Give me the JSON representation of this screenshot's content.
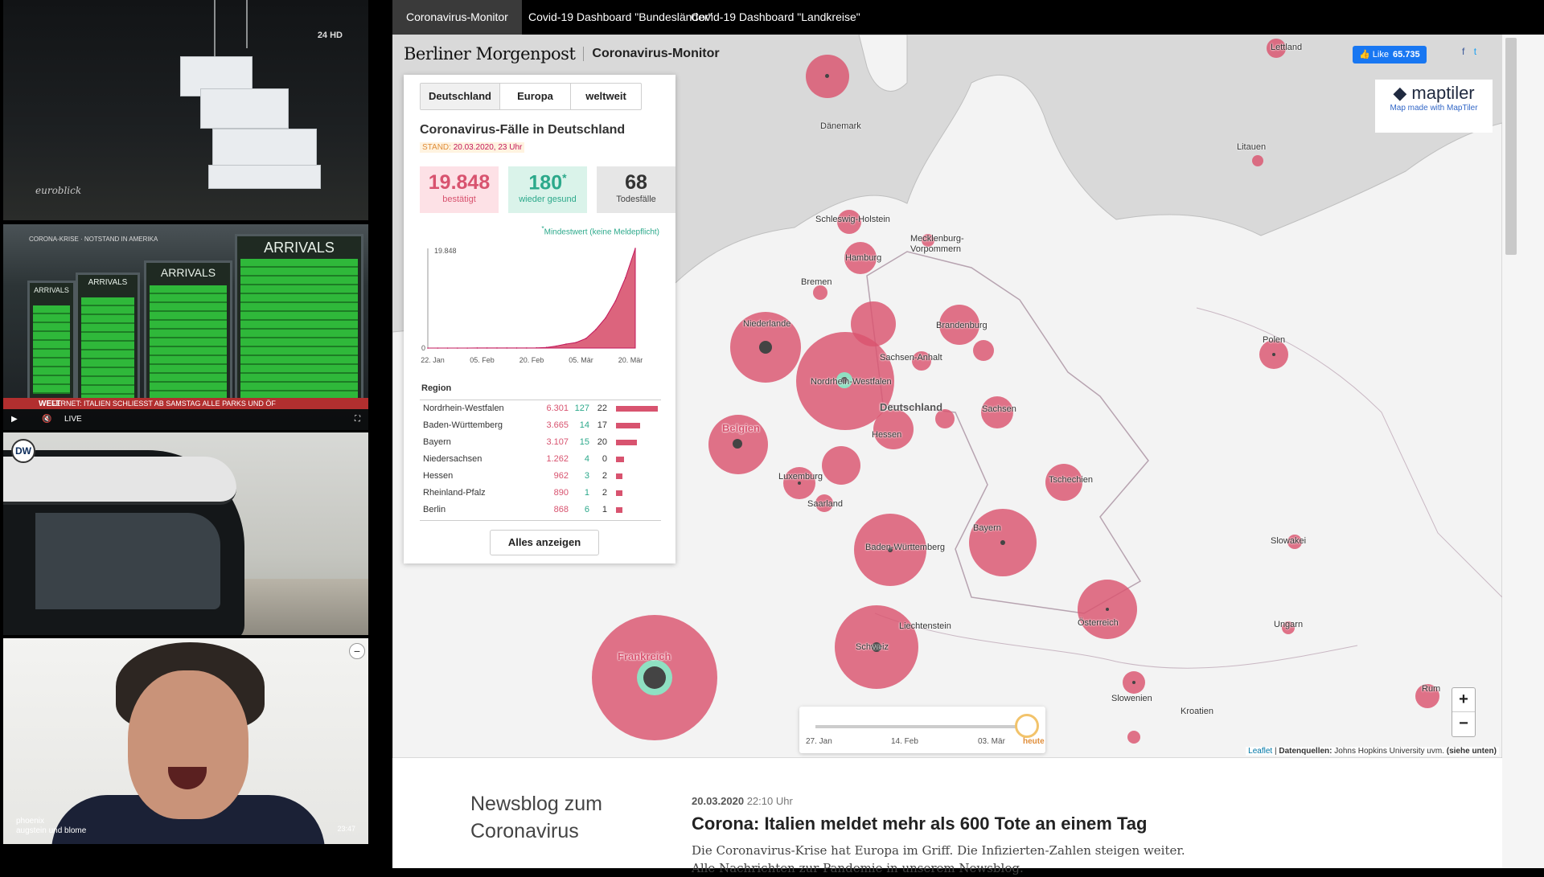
{
  "videos": {
    "tile1": {
      "channel_badge": "24\nHD",
      "logo_text": "euroblick"
    },
    "tile2": {
      "ticker_top": "CORONA-KRISE · NOTSTAND IN AMERIKA",
      "board_titles": [
        "ARRIVALS",
        "ARRIVALS",
        "ARRIVALS",
        "ARRIVALS"
      ],
      "ticker": "FERNET: ITALIEN SCHLIESST AB SAMSTAG ALLE PARKS UND ÖF",
      "live_label": "LIVE",
      "channel": "WELT"
    },
    "tile3": {
      "logo_text": "DW"
    },
    "tile4": {
      "line1": "phoenix",
      "line2": "augstein und blome",
      "time": "23:47"
    }
  },
  "tabs": [
    {
      "label": "Coronavirus-Monitor",
      "active": true
    },
    {
      "label": "Covid-19 Dashboard \"Bundesländer\"",
      "active": false
    },
    {
      "label": "Covid-19 Dashboard \"Landkreise\"",
      "active": false
    }
  ],
  "header": {
    "logo": "Berliner Morgenpost",
    "title": "Coronavirus-Monitor"
  },
  "facebook": {
    "like_label": "Like",
    "count": "65.735"
  },
  "maptiler": {
    "logo": "maptiler",
    "subtitle": "Map made with MapTiler"
  },
  "card": {
    "segments": [
      "Deutschland",
      "Europa",
      "weltweit"
    ],
    "title": "Coronavirus-Fälle in Deutschland",
    "stand_label": "STAND:",
    "stand_value": "20.03.2020, 23 Uhr",
    "kpis": {
      "confirmed": {
        "value": "19.848",
        "label": "bestätigt"
      },
      "recovered": {
        "value": "180",
        "sup": "*",
        "label": "wieder gesund"
      },
      "deaths": {
        "value": "68",
        "label": "Todesfälle"
      }
    },
    "note_star": "*",
    "note": "Mindestwert (keine Meldepflicht)",
    "region_title": "Region",
    "regions": [
      {
        "name": "Nordrhein-Westfalen",
        "cases": "6.301",
        "recovered": "127",
        "deaths": "22",
        "bar": 6301
      },
      {
        "name": "Baden-Württemberg",
        "cases": "3.665",
        "recovered": "14",
        "deaths": "17",
        "bar": 3665
      },
      {
        "name": "Bayern",
        "cases": "3.107",
        "recovered": "15",
        "deaths": "20",
        "bar": 3107
      },
      {
        "name": "Niedersachsen",
        "cases": "1.262",
        "recovered": "4",
        "deaths": "0",
        "bar": 1262
      },
      {
        "name": "Hessen",
        "cases": "962",
        "recovered": "3",
        "deaths": "2",
        "bar": 962
      },
      {
        "name": "Rheinland-Pfalz",
        "cases": "890",
        "recovered": "1",
        "deaths": "2",
        "bar": 890
      },
      {
        "name": "Berlin",
        "cases": "868",
        "recovered": "6",
        "deaths": "1",
        "bar": 868
      }
    ],
    "all_button": "Alles anzeigen"
  },
  "chart_data": {
    "type": "area",
    "x": [
      "22. Jan",
      "05. Feb",
      "20. Feb",
      "05. Mär",
      "20. Mär"
    ],
    "y_ticks": [
      "0",
      "19.848"
    ],
    "ylim": [
      0,
      19848
    ],
    "series": [
      {
        "values": [
          0,
          0,
          0,
          0,
          0,
          14,
          16,
          16,
          16,
          16,
          17,
          48,
          130,
          400,
          795,
          1112,
          1908,
          3675,
          6012,
          9367,
          13957,
          19848
        ]
      }
    ],
    "title": "",
    "xlabel": "",
    "ylabel": ""
  },
  "map": {
    "labels": [
      "Dänemark",
      "Litauen",
      "Schleswig-Holstein",
      "Mecklenburg-\nVorpommern",
      "Hamburg",
      "Bremen",
      "Niederlande",
      "Brandenburg",
      "Polen",
      "Nordrhein-Westfalen",
      "Sachsen-Anhalt",
      "Belgien",
      "Deutschland",
      "Hessen",
      "Sachsen",
      "Luxemburg",
      "Tschechien",
      "Saarland",
      "Bayern",
      "Baden-Württemberg",
      "Slowakei",
      "Österreich",
      "Liechtenstein",
      "Schweiz",
      "Ungarn",
      "Frankreich",
      "Slowenien",
      "Kroatien",
      "Rum",
      "Lettland"
    ],
    "timeline": {
      "ticks": [
        "27. Jan",
        "14. Feb",
        "03. Mär"
      ],
      "end": "heute",
      "position": 1.0
    },
    "zoom_in": "+",
    "zoom_out": "−",
    "attribution_leaflet": "Leaflet",
    "attribution_label": "Datenquellen:",
    "attribution_text": "Johns Hopkins University uvm.",
    "attribution_more": "(siehe unten)"
  },
  "news": {
    "heading": "Newsblog zum Coronavirus",
    "date": "20.03.2020",
    "time": "22:10 Uhr",
    "title": "Corona: Italien meldet mehr als 600 Tote an einem Tag",
    "body": "Die Coronavirus-Krise hat Europa im Griff. Die Infizierten-Zahlen steigen weiter. Alle Nachrichten zur Pandemie in unserem Newsblog."
  }
}
